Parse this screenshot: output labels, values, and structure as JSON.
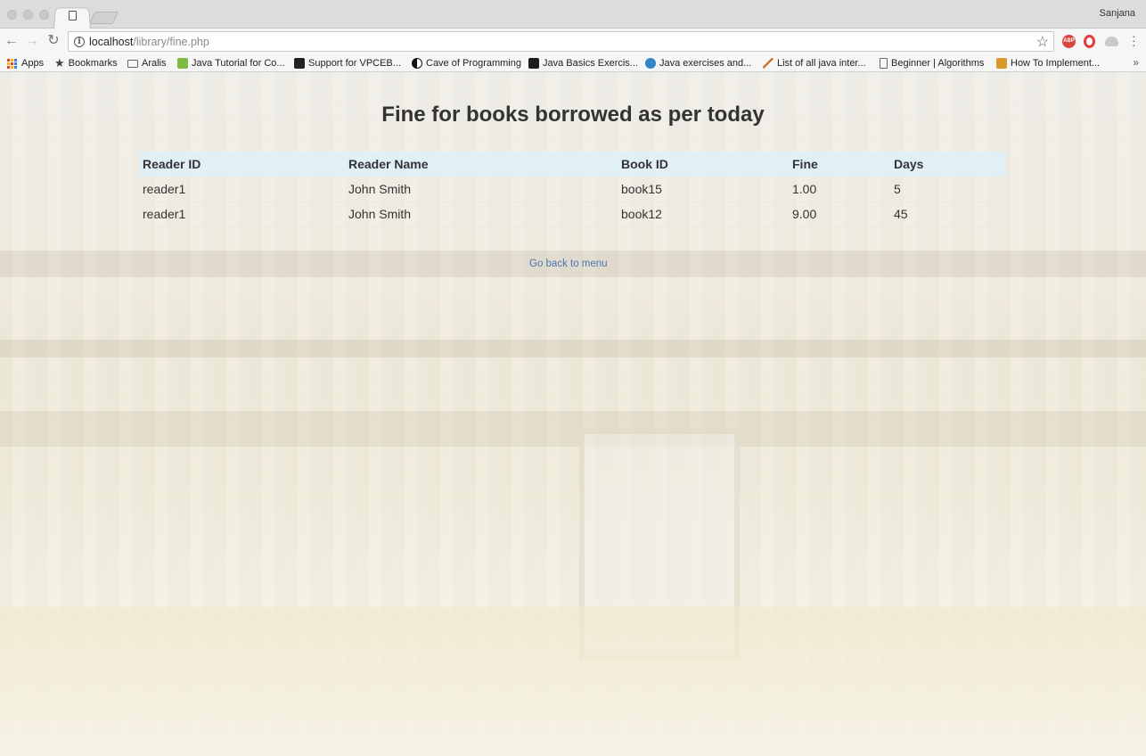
{
  "browser": {
    "profile_name": "Sanjana",
    "url_host": "localhost",
    "url_path": "/library/fine.php",
    "bookmarks": [
      {
        "label": "Apps",
        "icon": "apps-grid-icon"
      },
      {
        "label": "Bookmarks",
        "icon": "star-icon"
      },
      {
        "label": "Aralis",
        "icon": "folder-icon"
      },
      {
        "label": "Java Tutorial for Co...",
        "icon": "udemy-icon"
      },
      {
        "label": "Support for VPCEB...",
        "icon": "sony-icon"
      },
      {
        "label": "Cave of Programming",
        "icon": "yin-yang-icon"
      },
      {
        "label": "Java Basics Exercis...",
        "icon": "terminal-icon"
      },
      {
        "label": "Java exercises and...",
        "icon": "globe-icon"
      },
      {
        "label": "List of all java inter...",
        "icon": "feather-icon"
      },
      {
        "label": "Beginner | Algorithms",
        "icon": "page-icon"
      },
      {
        "label": "How To Implement...",
        "icon": "bracket-icon"
      }
    ],
    "more_bookmarks": "»",
    "extensions": [
      "abp-icon",
      "opera-icon",
      "cloud-icon"
    ],
    "ext_abp_label": "ABP"
  },
  "page": {
    "heading": "Fine for books borrowed as per today",
    "table": {
      "headers": [
        "Reader ID",
        "Reader Name",
        "Book ID",
        "Fine",
        "Days"
      ],
      "rows": [
        [
          "reader1",
          "John Smith",
          "book15",
          "1.00",
          "5"
        ],
        [
          "reader1",
          "John Smith",
          "book12",
          "9.00",
          "45"
        ]
      ]
    },
    "back_link": "Go back to menu"
  }
}
